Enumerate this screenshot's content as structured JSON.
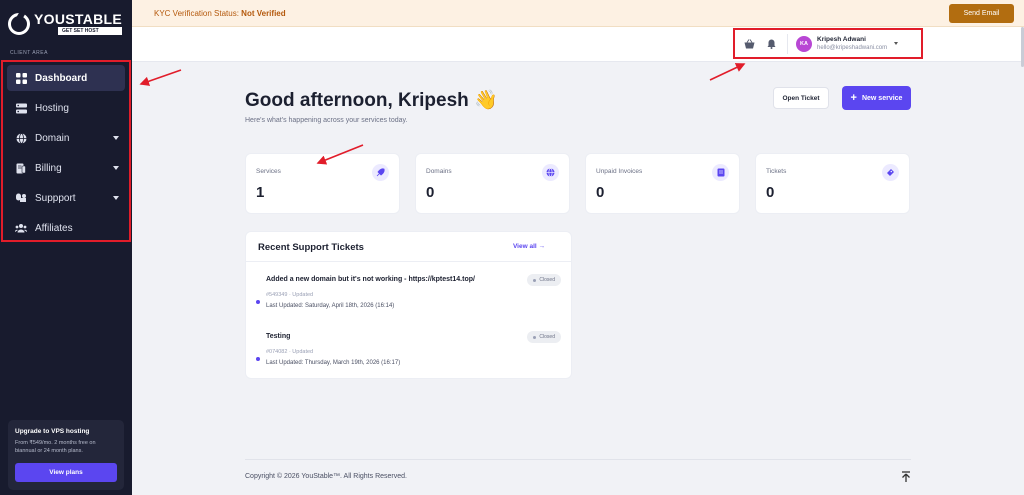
{
  "brand": {
    "name": "YOUSTABLE",
    "tagline": "GET SET HOST"
  },
  "sidebar": {
    "section_label": "CLIENT AREA",
    "items": [
      {
        "label": "Dashboard",
        "icon": "grid-icon",
        "active": true
      },
      {
        "label": "Hosting",
        "icon": "server-icon"
      },
      {
        "label": "Domain",
        "icon": "globe-icon",
        "expandable": true
      },
      {
        "label": "Billing",
        "icon": "receipt-icon",
        "expandable": true
      },
      {
        "label": "Suppport",
        "icon": "support-icon",
        "expandable": true
      },
      {
        "label": "Affiliates",
        "icon": "users-icon"
      }
    ],
    "upgrade": {
      "title": "Upgrade to VPS hosting",
      "description": "From ₹549/mo. 2 months free on biannual or 24 month plans.",
      "button": "View plans"
    }
  },
  "banner": {
    "kyc_label": "KYC Verification Status:",
    "kyc_status": "Not Verified",
    "send_email": "Send Email"
  },
  "header": {
    "user": {
      "initials": "KA",
      "name": "Kripesh Adwani",
      "email": "hello@kripeshadwani.com"
    }
  },
  "main": {
    "greeting": "Good afternoon, Kripesh 👋",
    "subtitle": "Here's what's happening across your services today.",
    "open_ticket": "Open Ticket",
    "new_service": "New service",
    "stats": [
      {
        "label": "Services",
        "value": "1",
        "icon": "rocket-icon"
      },
      {
        "label": "Domains",
        "value": "0",
        "icon": "globe-icon"
      },
      {
        "label": "Unpaid Invoices",
        "value": "0",
        "icon": "invoice-icon"
      },
      {
        "label": "Tickets",
        "value": "0",
        "icon": "ticket-icon"
      }
    ],
    "tickets": {
      "title": "Recent Support Tickets",
      "view_all": "View all →",
      "items": [
        {
          "title": "Added a new domain but it's not working - https://kptest14.top/",
          "meta": "#549349 · Updated",
          "updated": "Last Updated: Saturday, April 18th, 2026 (16:14)",
          "status": "Closed"
        },
        {
          "title": "Testing",
          "meta": "#074082 · Updated",
          "updated": "Last Updated: Thursday, March 19th, 2026 (16:17)",
          "status": "Closed"
        }
      ]
    }
  },
  "footer": {
    "copyright": "Copyright © 2026 YouStable™. All Rights Reserved."
  },
  "colors": {
    "accent": "#5b46f0",
    "sidebar": "#181b2e",
    "annotation": "#e11d2a",
    "warning": "#b26d10"
  }
}
